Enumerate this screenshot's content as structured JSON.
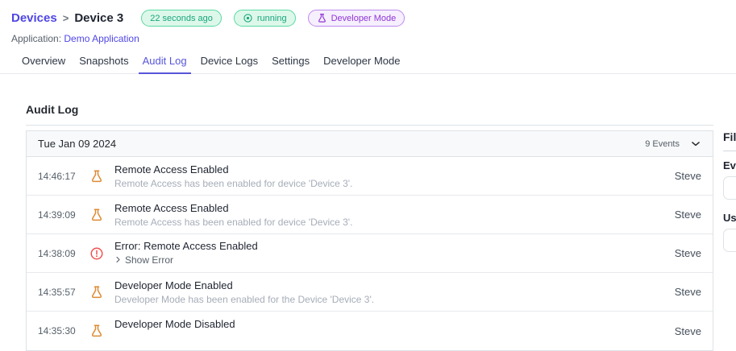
{
  "breadcrumb": {
    "parent": "Devices",
    "separator": ">",
    "current": "Device 3"
  },
  "badges": {
    "last_seen": "22 seconds ago",
    "status": "running",
    "mode": "Developer Mode"
  },
  "application": {
    "label": "Application:",
    "name": "Demo Application"
  },
  "tabs": [
    {
      "label": "Overview",
      "active": false
    },
    {
      "label": "Snapshots",
      "active": false
    },
    {
      "label": "Audit Log",
      "active": true
    },
    {
      "label": "Device Logs",
      "active": false
    },
    {
      "label": "Settings",
      "active": false
    },
    {
      "label": "Developer Mode",
      "active": false
    }
  ],
  "audit_log": {
    "title": "Audit Log",
    "group": {
      "date": "Tue Jan 09 2024",
      "events_count": "9 Events",
      "collapse_icon": "chevron-down"
    },
    "rows": [
      {
        "time": "14:46:17",
        "icon": "flask",
        "title": "Remote Access Enabled",
        "description": "Remote Access has been enabled for device 'Device 3'.",
        "user": "Steve"
      },
      {
        "time": "14:39:09",
        "icon": "flask",
        "title": "Remote Access Enabled",
        "description": "Remote Access has been enabled for device 'Device 3'.",
        "user": "Steve"
      },
      {
        "time": "14:38:09",
        "icon": "error-circle",
        "title": "Error: Remote Access Enabled",
        "link": "Show Error",
        "user": "Steve"
      },
      {
        "time": "14:35:57",
        "icon": "flask",
        "title": "Developer Mode Enabled",
        "description": "Developer Mode has been enabled for the Device 'Device 3'.",
        "user": "Steve"
      },
      {
        "time": "14:35:30",
        "icon": "flask",
        "title": "Developer Mode Disabled",
        "description": "",
        "user": "Steve"
      }
    ]
  },
  "filter_panel": {
    "title": "Filter",
    "event_type_label": "Event Type",
    "user_label": "User"
  },
  "colors": {
    "accent_indigo": "#4f46e5",
    "active_tab": "#5755d9",
    "badge_green_bg": "#ddf8ea",
    "badge_green_border": "#59d9a4",
    "badge_green_text": "#17a67c",
    "badge_purple_bg": "#f6effd",
    "badge_purple_border": "#bd8aee",
    "badge_purple_text": "#8f35d8",
    "flask_orange": "#dd8b33",
    "error_red": "#ef5350",
    "table_border": "#dee2e6",
    "table_head_bg": "#f8f9fa"
  }
}
